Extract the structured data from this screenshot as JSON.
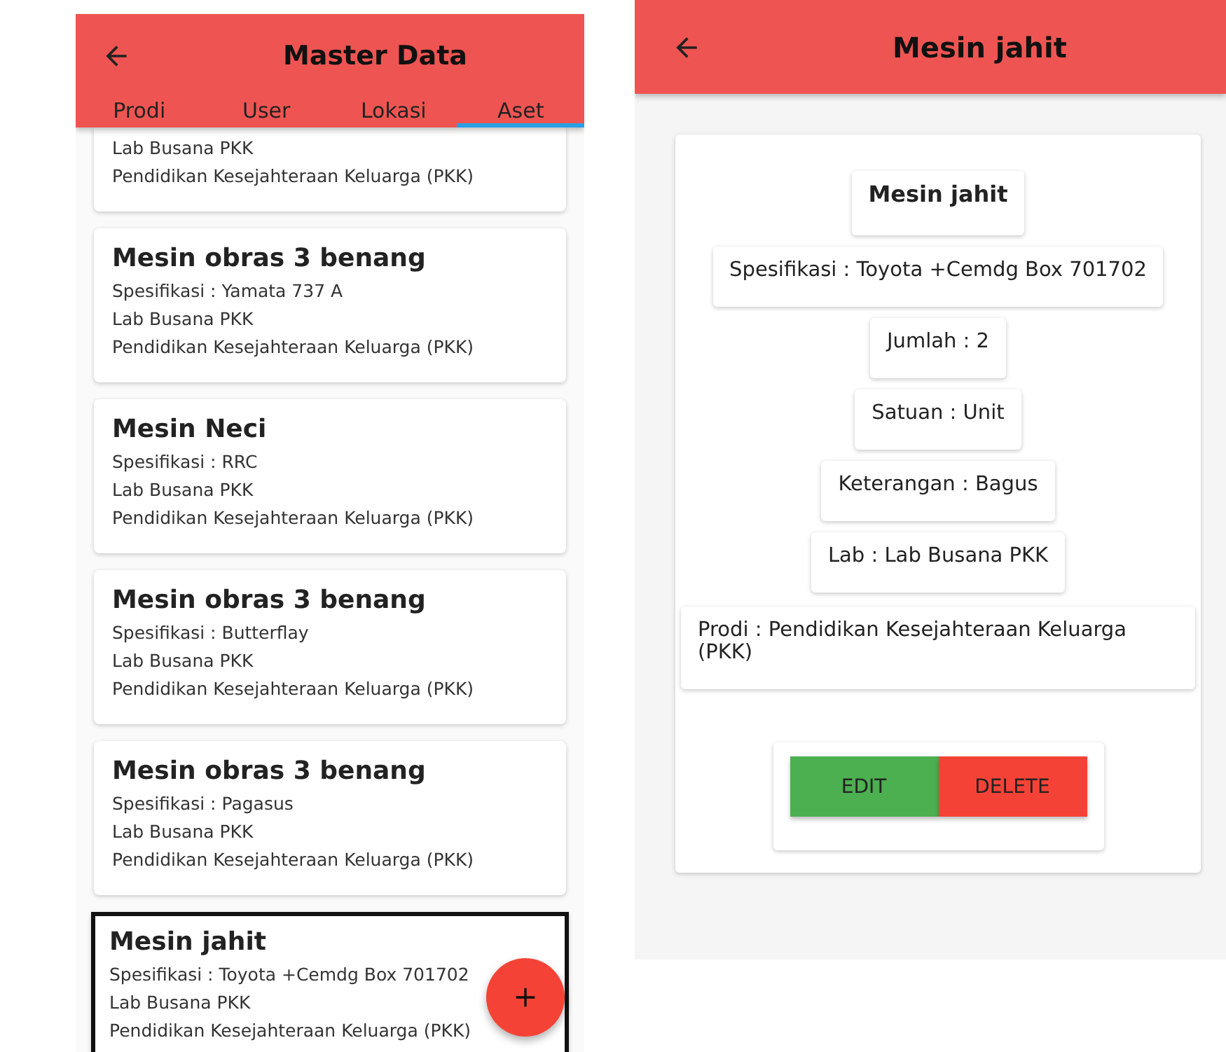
{
  "list_screen": {
    "title": "Master Data",
    "tabs": [
      {
        "label": "Prodi",
        "selected": false
      },
      {
        "label": "User",
        "selected": false
      },
      {
        "label": "Lokasi",
        "selected": false
      },
      {
        "label": "Aset",
        "selected": true
      }
    ],
    "assets": [
      {
        "lab": "Lab Busana PKK",
        "prodi": "Pendidikan Kesejahteraan Keluarga (PKK)",
        "selected": false
      },
      {
        "name": "Mesin obras 3 benang",
        "spec": "Spesifikasi : Yamata 737 A",
        "lab": "Lab Busana PKK",
        "prodi": "Pendidikan Kesejahteraan Keluarga (PKK)",
        "selected": false
      },
      {
        "name": "Mesin Neci",
        "spec": "Spesifikasi : RRC",
        "lab": "Lab Busana PKK",
        "prodi": "Pendidikan Kesejahteraan Keluarga (PKK)",
        "selected": false
      },
      {
        "name": "Mesin obras  3 benang",
        "spec": "Spesifikasi : Butterflay",
        "lab": "Lab Busana PKK",
        "prodi": "Pendidikan Kesejahteraan Keluarga (PKK)",
        "selected": false
      },
      {
        "name": "Mesin obras 3 benang",
        "spec": "Spesifikasi : Pagasus",
        "lab": "Lab Busana PKK",
        "prodi": "Pendidikan Kesejahteraan Keluarga (PKK)",
        "selected": false
      },
      {
        "name": "Mesin jahit",
        "spec": "Spesifikasi : Toyota +Cemdg Box 701702",
        "lab": "Lab Busana PKK",
        "prodi": "Pendidikan Kesejahteraan Keluarga (PKK)",
        "selected": true
      }
    ]
  },
  "detail_screen": {
    "title": "Mesin jahit",
    "fields": [
      {
        "kind": "title",
        "text": "Mesin jahit"
      },
      {
        "kind": "line",
        "text": "Spesifikasi : Toyota +Cemdg Box 701702"
      },
      {
        "kind": "line",
        "text": "Jumlah : 2"
      },
      {
        "kind": "line",
        "text": "Satuan : Unit"
      },
      {
        "kind": "line",
        "text": "Keterangan : Bagus"
      },
      {
        "kind": "line",
        "text": "Lab : Lab Busana PKK"
      },
      {
        "kind": "wide",
        "text": "Prodi : Pendidikan Kesejahteraan Keluarga (PKK)"
      }
    ],
    "buttons": [
      {
        "kind": "edit",
        "label": "EDIT"
      },
      {
        "kind": "delete",
        "label": "DELETE"
      }
    ]
  }
}
